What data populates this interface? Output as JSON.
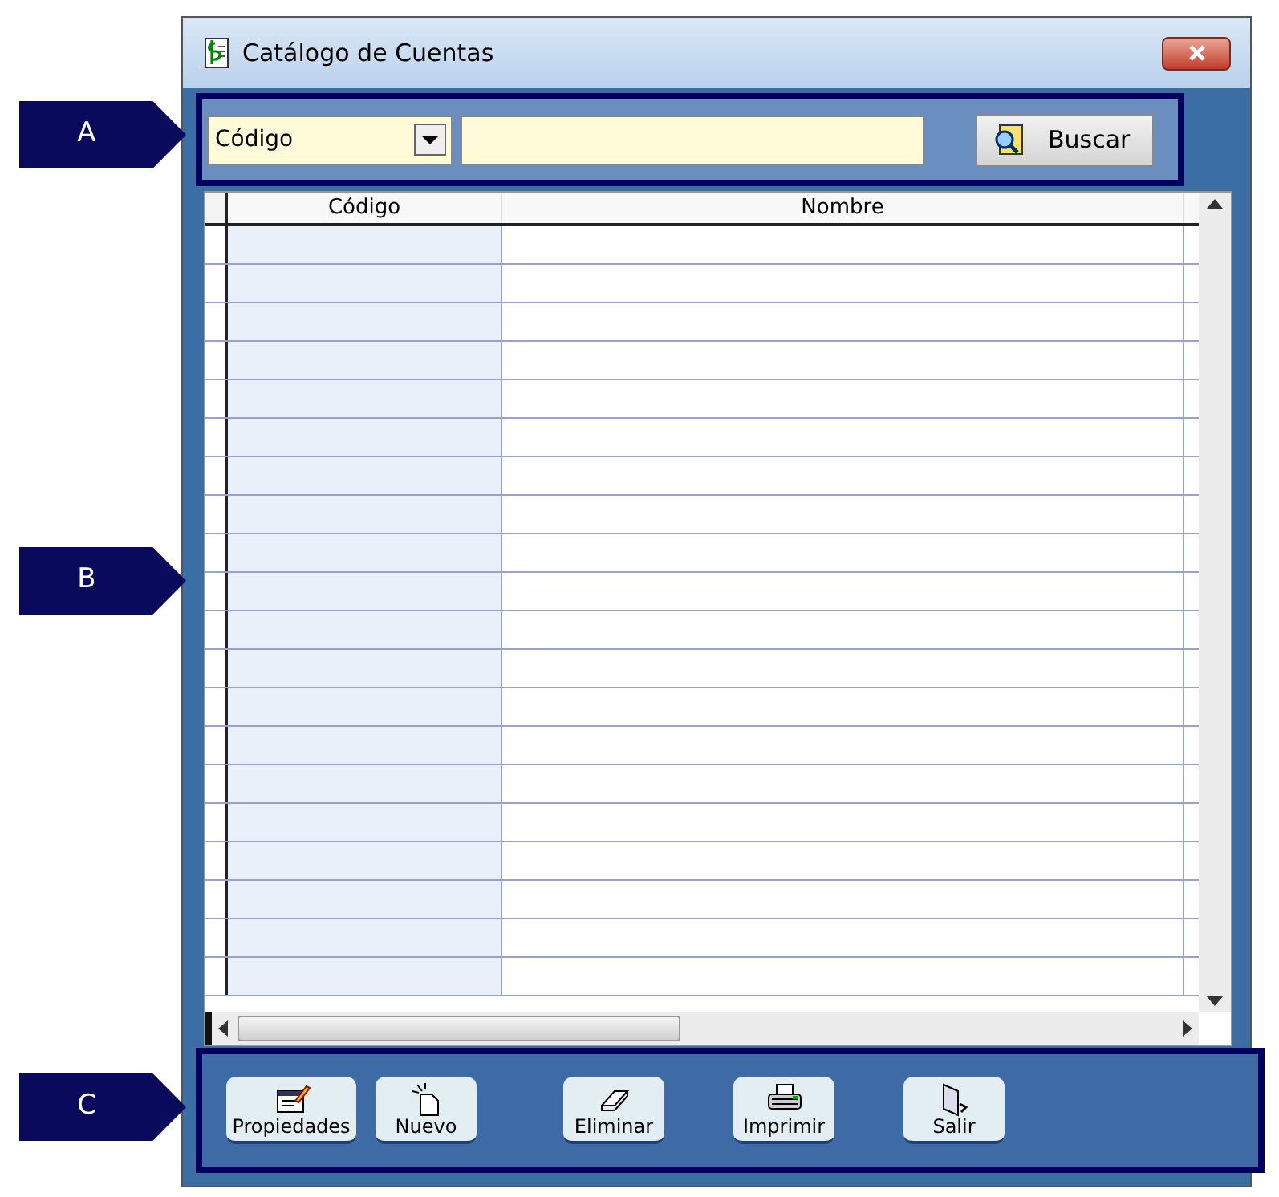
{
  "window": {
    "title": "Catálogo de Cuentas"
  },
  "callouts": [
    "A",
    "B",
    "C"
  ],
  "search": {
    "field": "Código",
    "button": "Buscar"
  },
  "table": {
    "columns": [
      "Código",
      "Nombre"
    ]
  },
  "buttons": [
    "Propiedades",
    "Nuevo",
    "Eliminar",
    "Imprimir",
    "Salir"
  ]
}
